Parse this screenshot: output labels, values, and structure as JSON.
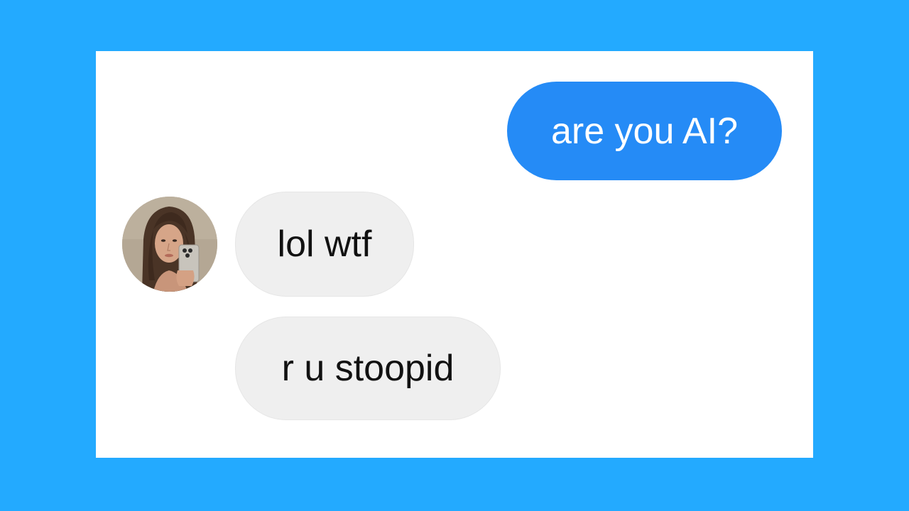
{
  "colors": {
    "background": "#23aaff",
    "panel": "#ffffff",
    "sent_bubble": "#258bf6",
    "sent_text": "#ffffff",
    "received_bubble": "#efefef",
    "received_text": "#111111"
  },
  "messages": [
    {
      "direction": "sent",
      "text": "are you AI?"
    },
    {
      "direction": "received",
      "text": "lol wtf"
    },
    {
      "direction": "received",
      "text": "r u stoopid"
    }
  ],
  "contact": {
    "avatar_icon": "avatar-photo-icon"
  }
}
